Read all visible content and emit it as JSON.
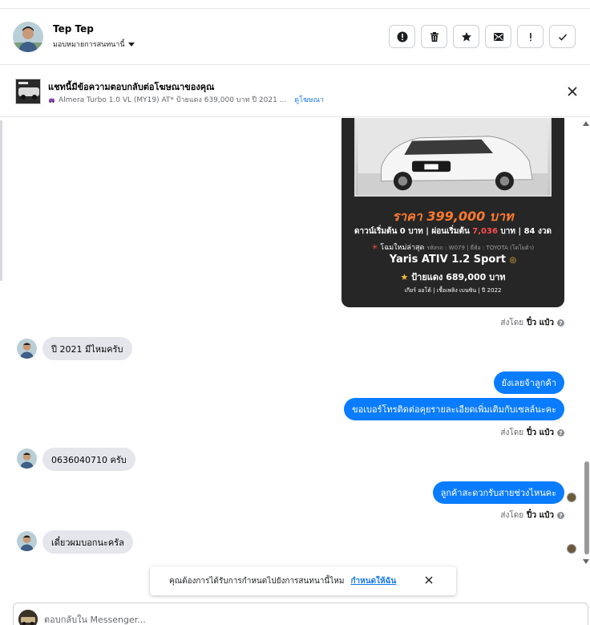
{
  "header": {
    "name": "Tep Tep",
    "assign_label": "มอบหมายการสนทนานี้"
  },
  "toolbar": {
    "icons": [
      "alert-circle-icon",
      "trash-icon",
      "star-icon",
      "mark-unread-icon",
      "exclamation-icon",
      "check-icon"
    ]
  },
  "ad_banner": {
    "title": "แชทนี้มีข้อความตอบกลับต่อโฆษณาของคุณ",
    "subtitle": "Almera Turbo 1.0 VL (MY19) AT* ป้ายแดง 639,000 บาท ปี 2021 ...",
    "link": "ดูโฆษณา"
  },
  "ad_card": {
    "price": "ราคา 399,000 บาท",
    "down_prefix": "ดาวน์เริ่มต้น 0 บาท | ผ่อนเริ่มต้น",
    "down_amount": "7,036",
    "down_suffix": "บาท | 84 งวด",
    "new_badge": "โฉมใหม่ล่าสุด",
    "small_meta": "รหัสรถ : W079 | ยี่ห้อ : TOYOTA (โตโยต้า)",
    "model": "Yaris ATIV 1.2 Sport",
    "plate_price": "ป้ายแดง 689,000 บาท",
    "specs": "เกียร์ ออโต้  |  เชื้อเพลิง เบนซิน  |  ปี 2022"
  },
  "messages": {
    "sent_by_prefix": "ส่งโดย",
    "sender": "ปิ๋ว แป๋ว",
    "in_1": "ปี 2021 มีไหมครับ",
    "out_1": "ยังเลยจ้าลูกค้า",
    "out_2": "ขอเบอร์โทรติดต่อคุยรายละเอียดเพิ่มเติมกับเซลล์นะคะ",
    "in_2": "0636040710 ครับ",
    "out_3": "ลูกค้าสะดวกรับสายช่วงไหนคะ",
    "in_3": "เดี๋ยวผมบอกนะครัล"
  },
  "toast": {
    "text": "คุณต้องการได้รับการกำหนดไปยังการสนทนานี้ไหม",
    "link": "กำหนดให้ฉัน"
  },
  "composer": {
    "placeholder": "ตอบกลับใน Messenger..."
  },
  "colors": {
    "outgoing_bubble": "#0a7cff",
    "incoming_bubble": "#e4e6eb",
    "link": "#1877f2"
  }
}
